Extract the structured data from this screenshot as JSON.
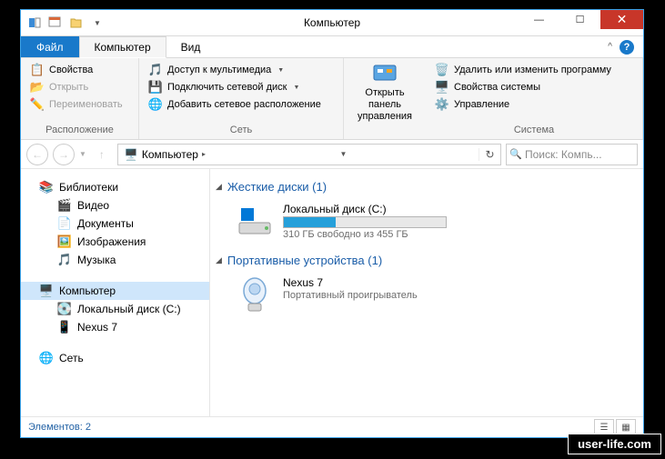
{
  "title": "Компьютер",
  "tabs": {
    "file": "Файл",
    "computer": "Компьютер",
    "view": "Вид"
  },
  "ribbon": {
    "location": {
      "label": "Расположение",
      "properties": "Свойства",
      "open": "Открыть",
      "rename": "Переименовать"
    },
    "network": {
      "label": "Сеть",
      "media": "Доступ к мультимедиа",
      "mapdrive": "Подключить сетевой диск",
      "addloc": "Добавить сетевое расположение"
    },
    "system": {
      "label": "Система",
      "openpanel": "Открыть панель\nуправления",
      "uninstall": "Удалить или изменить программу",
      "sysprops": "Свойства системы",
      "manage": "Управление"
    }
  },
  "address": {
    "computer": "Компьютер",
    "search_placeholder": "Поиск: Компь..."
  },
  "sidebar": {
    "libraries": "Библиотеки",
    "video": "Видео",
    "documents": "Документы",
    "images": "Изображения",
    "music": "Музыка",
    "computer": "Компьютер",
    "localdisk": "Локальный диск (C:)",
    "nexus": "Nexus 7",
    "network": "Сеть"
  },
  "main": {
    "hdd_header": "Жесткие диски (1)",
    "drive_name": "Локальный диск (C:)",
    "drive_free": "310 ГБ свободно из 455 ГБ",
    "drive_fill_pct": 32,
    "portable_header": "Портативные устройства (1)",
    "device_name": "Nexus 7",
    "device_type": "Портативный проигрыватель"
  },
  "status": {
    "elements": "Элементов: 2"
  },
  "watermark": "user-life.com"
}
